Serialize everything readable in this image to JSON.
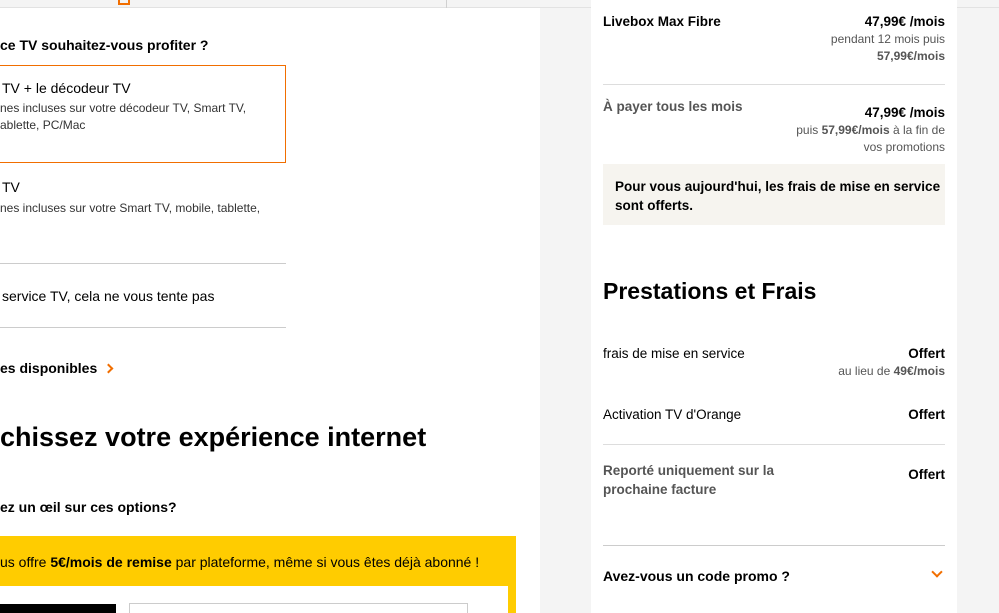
{
  "tv_question": {
    "title": "ce TV souhaitez-vous profiter ?",
    "options": [
      {
        "title": "TV + le décodeur TV",
        "desc_line1": "nes incluses sur votre décodeur TV, Smart TV,",
        "desc_line2": "ablette, PC/Mac"
      },
      {
        "title": "TV",
        "desc_line1": "nes incluses sur votre Smart TV, mobile, tablette,"
      },
      {
        "title": "service TV, cela ne vous tente pas"
      }
    ],
    "more_link": "es disponibles"
  },
  "enrich": {
    "heading": "chissez votre expérience internet",
    "sub_question": "ez un œil sur ces options?",
    "banner_pre": "us offre ",
    "banner_bold": "5€/mois de remise",
    "banner_post": " par plateforme, même si vous êtes déjà abonné !"
  },
  "summary": {
    "offer_name": "Livebox Max Fibre",
    "offer_price": "47,99€ /mois",
    "offer_promo_line1": "pendant 12 mois puis",
    "offer_promo_line2": "57,99€/mois",
    "monthly_label": "À payer tous les mois",
    "monthly_price": "47,99€ /mois",
    "monthly_after_pre": "puis ",
    "monthly_after_bold": "57,99€/mois",
    "monthly_after_post": " à la fin de",
    "monthly_after_line2": "vos promotions",
    "info_text": "Pour vous aujourd'hui, les frais de mise en service sont offerts."
  },
  "fees": {
    "heading": "Prestations et Frais",
    "items": [
      {
        "label": "frais de mise en service",
        "value": "Offert",
        "note_pre": "au lieu de ",
        "note_bold": "49€/mois"
      },
      {
        "label": "Activation TV d'Orange",
        "value": "Offert"
      },
      {
        "label_line1": "Reporté uniquement sur la",
        "label_line2": "prochaine facture",
        "value": "Offert"
      }
    ],
    "promo_code_label": "Avez-vous un code promo ?"
  },
  "colors": {
    "accent": "#f16e00",
    "banner": "#ffcc00"
  }
}
